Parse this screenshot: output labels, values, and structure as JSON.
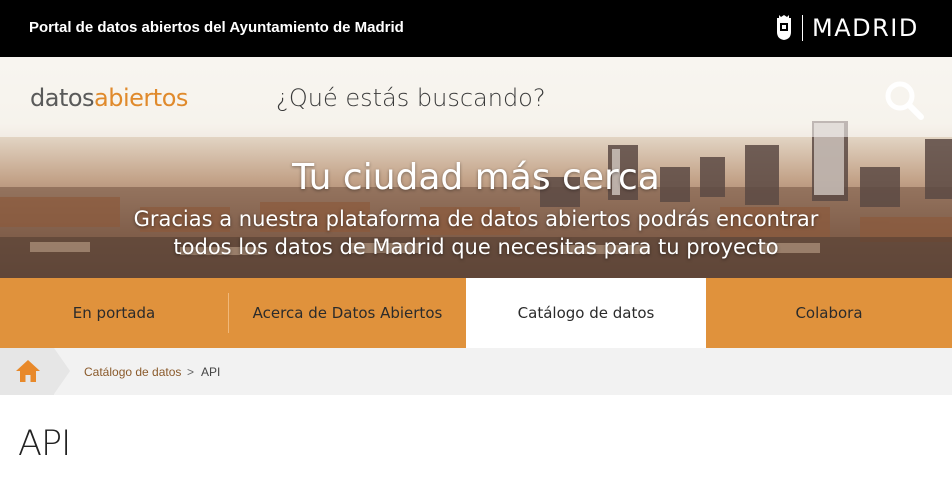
{
  "header": {
    "portal_title": "Portal de datos abiertos del Ayuntamiento de Madrid",
    "logo_text": "MADRID"
  },
  "hero": {
    "logo_part1": "datos",
    "logo_part2": "abiertos",
    "search_placeholder": "¿Qué estás buscando?",
    "title": "Tu ciudad más cerca",
    "subtitle_line1": "Gracias a nuestra plataforma de datos abiertos podrás encontrar",
    "subtitle_line2": "todos los datos de Madrid que necesitas para tu proyecto"
  },
  "nav": {
    "tabs": [
      {
        "label": "En portada"
      },
      {
        "label": "Acerca de Datos Abiertos"
      },
      {
        "label": "Catálogo de datos"
      },
      {
        "label": "Colabora"
      }
    ],
    "active": "Catálogo de datos"
  },
  "breadcrumb": {
    "link": "Catálogo de datos",
    "separator": ">",
    "current": "API"
  },
  "page": {
    "title": "API"
  },
  "colors": {
    "accent": "#e0923c",
    "topbar": "#000000",
    "logo_orange": "#e08a2c"
  },
  "icons": [
    "madrid-crest-icon",
    "search-icon",
    "home-icon"
  ]
}
